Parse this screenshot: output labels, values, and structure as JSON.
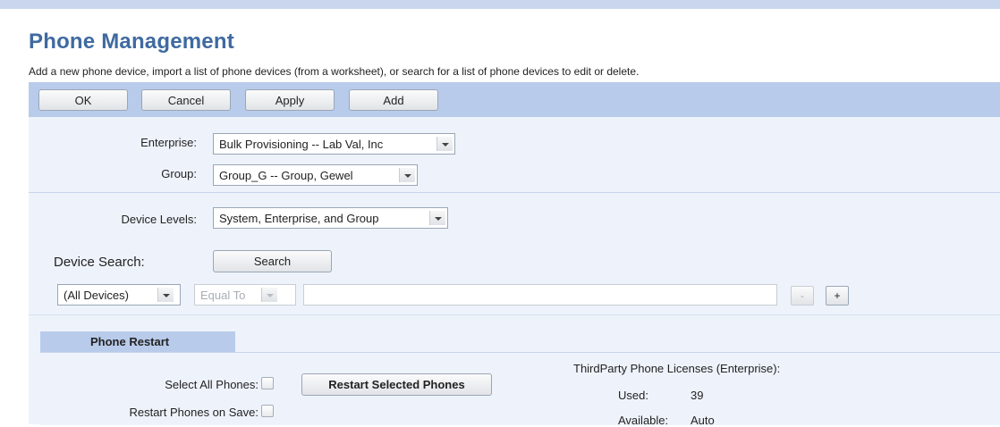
{
  "header": {
    "title": "Phone Management",
    "subtitle": "Add a new phone device, import a list of phone devices (from a worksheet), or search for a list of phone devices to edit or delete."
  },
  "toolbar": {
    "ok_label": "OK",
    "cancel_label": "Cancel",
    "apply_label": "Apply",
    "add_label": "Add"
  },
  "filters": {
    "enterprise_label": "Enterprise:",
    "enterprise_value": "Bulk Provisioning -- Lab Val, Inc",
    "group_label": "Group:",
    "group_value": "Group_G -- Group, Gewel",
    "device_levels_label": "Device Levels:",
    "device_levels_value": "System, Enterprise, and Group"
  },
  "search": {
    "label": "Device Search:",
    "button_label": "Search",
    "criteria_value": "(All Devices)",
    "operator_value": "Equal To",
    "query_value": "",
    "remove_label": "-",
    "add_label": "+"
  },
  "restart": {
    "tab_label": "Phone Restart",
    "select_all_label": "Select All Phones:",
    "restart_button_label": "Restart Selected Phones",
    "restart_on_save_label": "Restart Phones on Save:",
    "licenses_title": "ThirdParty Phone Licenses (Enterprise):",
    "used_label": "Used:",
    "used_value": "39",
    "available_label": "Available:",
    "available_value": "Auto"
  },
  "colors": {
    "title": "#3f6aa0",
    "toolbar_bg": "#b8cbea",
    "panel_bg": "#eef3fb"
  }
}
